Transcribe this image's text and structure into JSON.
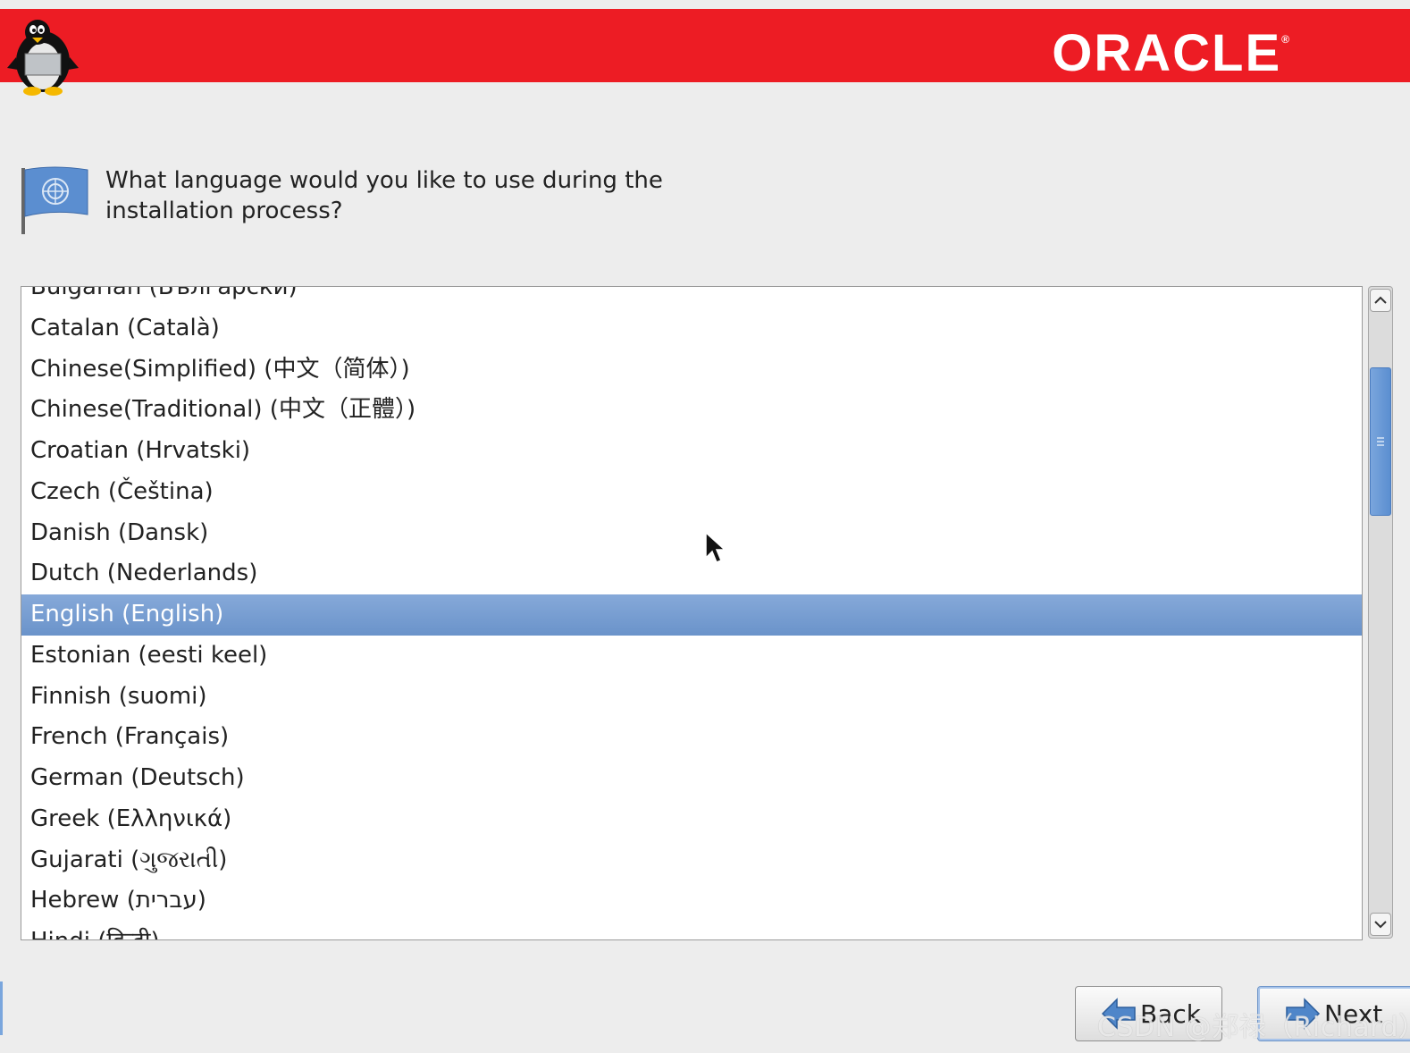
{
  "header": {
    "brand": "ORACLE",
    "brand_mark": "®",
    "banner_color": "#ed1c24"
  },
  "question": {
    "line1": "What language would you like to use during the",
    "line2": "installation process?"
  },
  "languages": [
    "Bulgarian (Български)",
    "Catalan (Català)",
    "Chinese(Simplified) (中文（简体）)",
    "Chinese(Traditional) (中文（正體）)",
    "Croatian (Hrvatski)",
    "Czech (Čeština)",
    "Danish (Dansk)",
    "Dutch (Nederlands)",
    "English (English)",
    "Estonian (eesti keel)",
    "Finnish (suomi)",
    "French (Français)",
    "German (Deutsch)",
    "Greek (Ελληνικά)",
    "Gujarati (ગુજરાતી)",
    "Hebrew (עברית)",
    "Hindi (हिन्दी)"
  ],
  "selected_language": "English (English)",
  "selection_color": "#6a93ca",
  "buttons": {
    "back": "Back",
    "next": "Next"
  },
  "watermark": "CSDN @郑禄（Richard）"
}
